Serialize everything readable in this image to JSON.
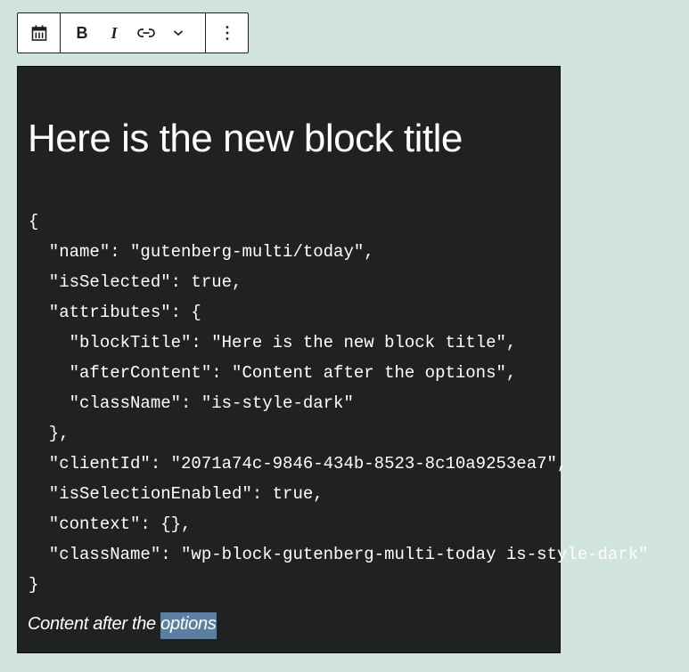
{
  "toolbar": {
    "groups": [
      {
        "items": [
          {
            "icon": "calendar-icon",
            "label": "Block type"
          }
        ]
      },
      {
        "items": [
          {
            "icon": "bold-icon",
            "glyph": "B",
            "label": "Bold"
          },
          {
            "icon": "italic-icon",
            "glyph": "I",
            "label": "Italic"
          },
          {
            "icon": "link-icon",
            "label": "Link"
          },
          {
            "icon": "chevron-down-icon",
            "label": "More rich text controls"
          }
        ]
      },
      {
        "items": [
          {
            "icon": "more-vertical-icon",
            "label": "Options"
          }
        ]
      }
    ]
  },
  "block": {
    "title": "Here is the new block title",
    "code_lines": [
      "{",
      "  \"name\": \"gutenberg-multi/today\",",
      "  \"isSelected\": true,",
      "  \"attributes\": {",
      "    \"blockTitle\": \"Here is the new block title\",",
      "    \"afterContent\": \"Content after the options\",",
      "    \"className\": \"is-style-dark\"",
      "  },",
      "  \"clientId\": \"2071a74c-9846-434b-8523-8c10a9253ea7\",",
      "  \"isSelectionEnabled\": true,",
      "  \"context\": {},",
      "  \"className\": \"wp-block-gutenberg-multi-today is-style-dark\"",
      "}"
    ],
    "after_content": {
      "before_selection": "Content after the ",
      "selected_text": "options"
    }
  },
  "colors": {
    "page_background": "#d1e3de",
    "block_background": "#202222",
    "selection": "#5b7fa3"
  }
}
